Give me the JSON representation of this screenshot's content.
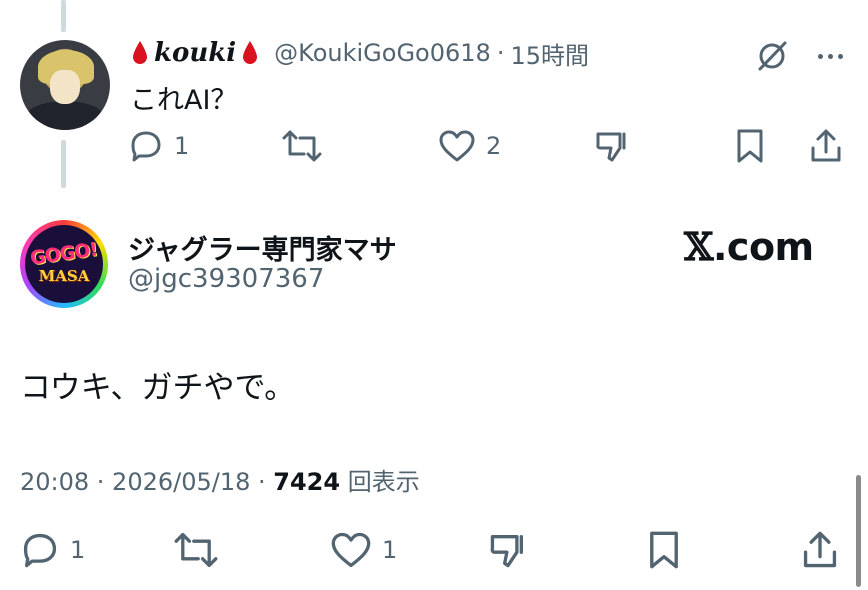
{
  "reply": {
    "name": "𝒌𝒐𝒖𝒌𝒊",
    "handle": "@KoukiGoGo0618",
    "time": "15時間",
    "text": "これAI？",
    "reply_count": "1",
    "retweet_count": "",
    "like_count": "2"
  },
  "main": {
    "name": "ジャグラー専門家マサ",
    "handle": "@jgc39307367",
    "avatar_text_top": "GOGO!",
    "avatar_text_bottom": "MASA",
    "watermark_x": "𝕏",
    "watermark_rest": ".com",
    "text": "コウキ、ガチやで。",
    "timestamp": "20:08 · 2026/05/18 · ",
    "views": "7424",
    "views_label": " 回表示",
    "reply_count": "1",
    "like_count": "1"
  },
  "colors": {
    "text": "#0f1419",
    "secondary": "#536471",
    "thread_line": "#cfd9de",
    "drop_red": "#d8121f"
  },
  "icons": [
    "blood-drop-icon",
    "grok-icon",
    "more-icon",
    "reply-icon",
    "retweet-icon",
    "like-icon",
    "dislike-icon",
    "bookmark-icon",
    "share-icon"
  ]
}
